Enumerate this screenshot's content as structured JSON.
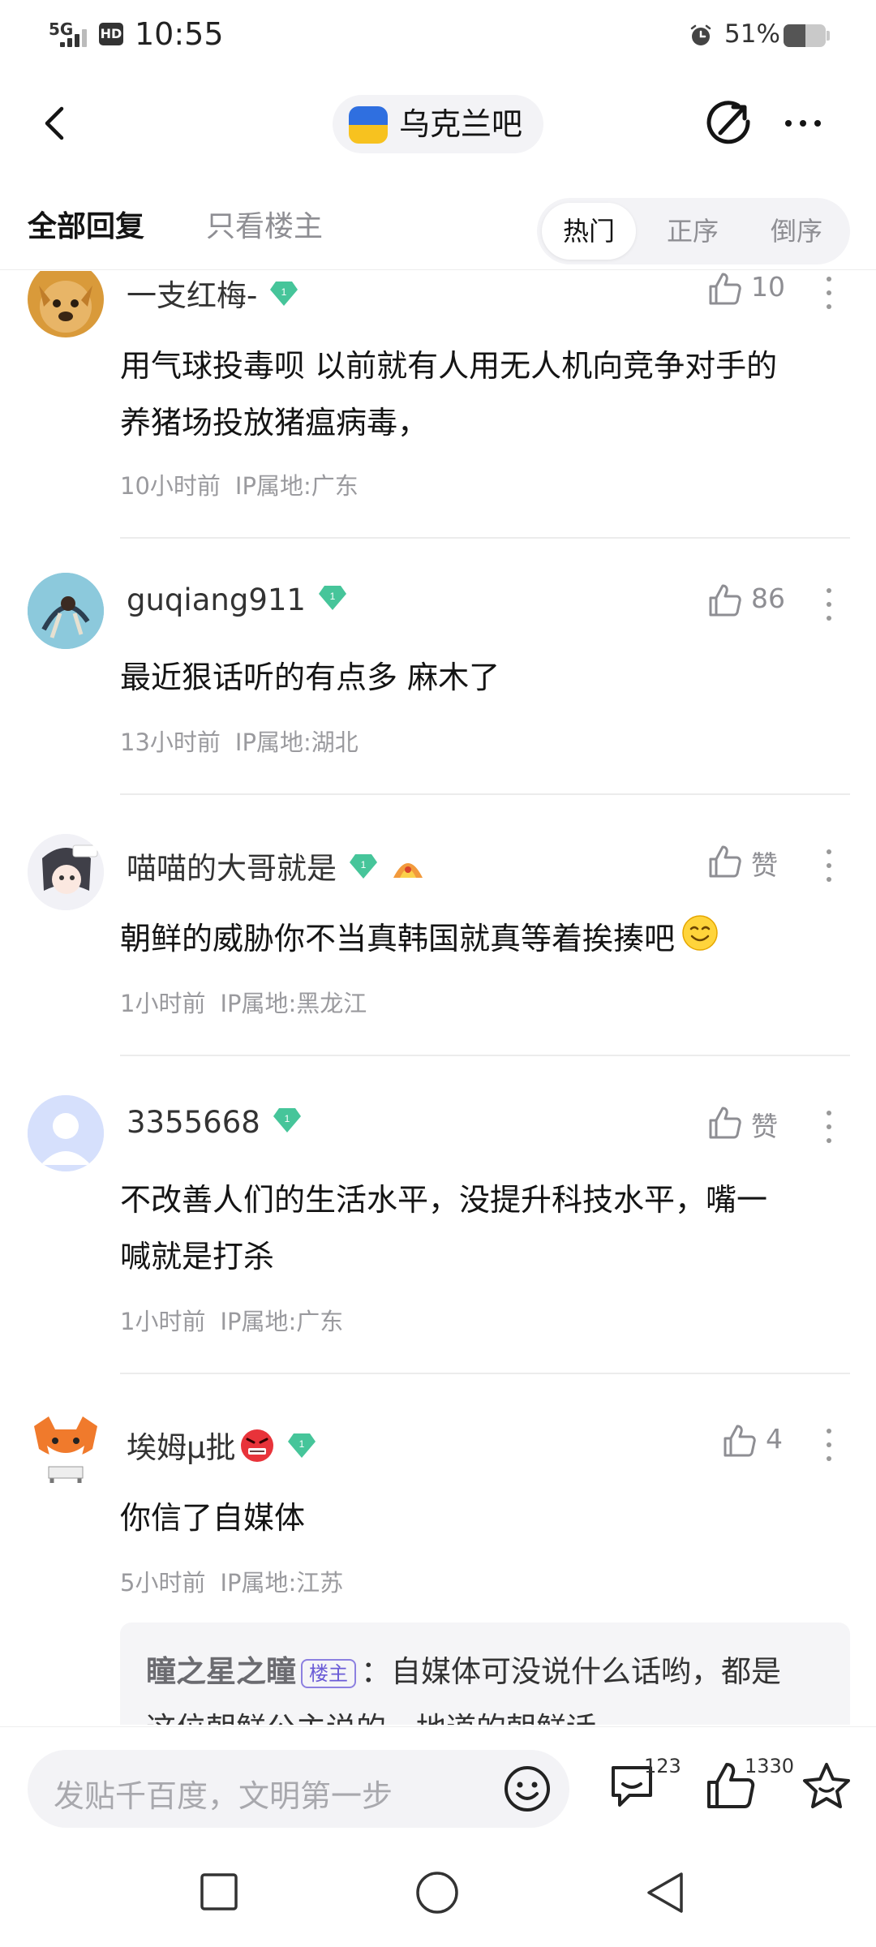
{
  "status_bar": {
    "network": "5G",
    "hd": "HD",
    "time": "10:55",
    "battery_percent": "51%",
    "battery_level": 0.51
  },
  "nav": {
    "title": "乌克兰吧"
  },
  "tabs": {
    "all_replies": "全部回复",
    "op_only": "只看楼主",
    "sort_options": [
      "热门",
      "正序",
      "倒序"
    ],
    "active_sort": "热门"
  },
  "posts": [
    {
      "username": "一支红梅-",
      "level": "1",
      "likes": "10",
      "lines": [
        "用气球投毒呗 以前就有人用无人机向竞争对手的",
        "养猪场投放猪瘟病毒，"
      ],
      "time": "10小时前",
      "ip": "IP属地:广东"
    },
    {
      "username": "guqiang911",
      "level": "1",
      "likes": "86",
      "lines": [
        "最近狠话听的有点多 麻木了"
      ],
      "time": "13小时前",
      "ip": "IP属地:湖北"
    },
    {
      "username": "喵喵的大哥就是",
      "level": "1",
      "likes": "赞",
      "lines": [
        "朝鲜的威胁你不当真韩国就真等着挨揍吧"
      ],
      "time": "1小时前",
      "ip": "IP属地:黑龙江"
    },
    {
      "username": "3355668",
      "level": "1",
      "likes": "赞",
      "lines": [
        "不改善人们的生活水平，没提升科技水平，嘴一",
        "喊就是打杀"
      ],
      "time": "1小时前",
      "ip": "IP属地:广东"
    },
    {
      "username": "埃姆μ批",
      "level": "1",
      "likes": "4",
      "lines": [
        "你信了自媒体"
      ],
      "time": "5小时前",
      "ip": "IP属地:江苏",
      "reply": {
        "user": "瞳之星之瞳",
        "tag": "楼主",
        "text_line1": "自媒体可没说什么话哟，都是",
        "text_line2": "这位朝鲜公主说的，地道的朝鲜话"
      }
    }
  ],
  "input_bar": {
    "placeholder": "发贴千百度，文明第一步",
    "comment_count": "123",
    "like_count": "1330"
  }
}
